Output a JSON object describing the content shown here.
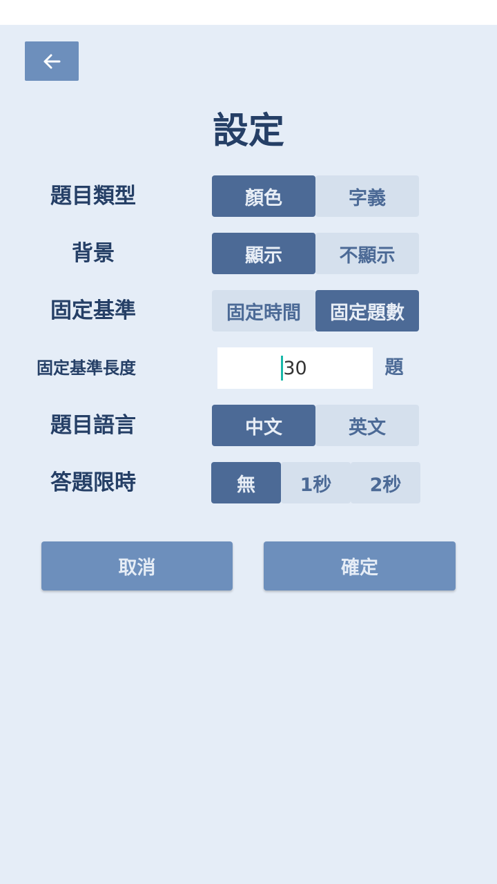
{
  "title": "設定",
  "back_icon": "arrow-left-icon",
  "question_type": {
    "label": "題目類型",
    "options": [
      "顏色",
      "字義"
    ],
    "selected": 0
  },
  "background": {
    "label": "背景",
    "options": [
      "顯示",
      "不顯示"
    ],
    "selected": 0
  },
  "fixed_basis": {
    "label": "固定基準",
    "options": [
      "固定時間",
      "固定題數"
    ],
    "selected": 1
  },
  "basis_length": {
    "label": "固定基準長度",
    "value": "30",
    "unit": "題"
  },
  "language": {
    "label": "題目語言",
    "options": [
      "中文",
      "英文"
    ],
    "selected": 0
  },
  "time_limit": {
    "label": "答題限時",
    "options": [
      "無",
      "1秒",
      "2秒"
    ],
    "selected": 0
  },
  "actions": {
    "cancel": "取消",
    "confirm": "確定"
  },
  "colors": {
    "background": "#e5edf7",
    "selected": "#4c6a96",
    "unselected": "#d5e0ed",
    "button": "#6d8fbc",
    "text": "#253f66"
  }
}
